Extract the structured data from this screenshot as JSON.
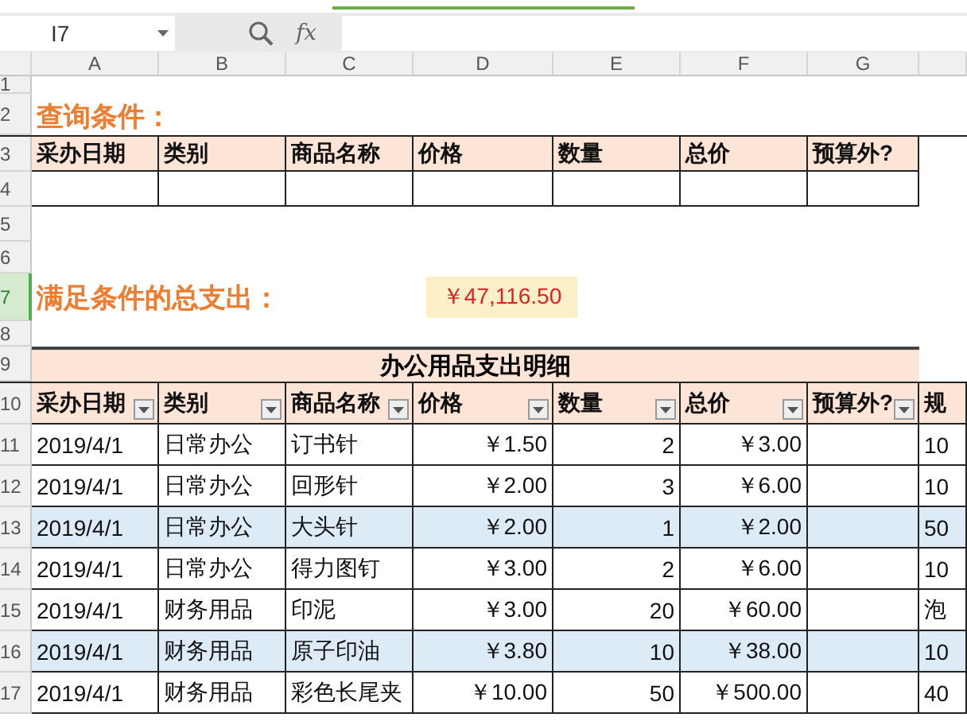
{
  "name_box": "I7",
  "formula_label": "fx",
  "column_headers": [
    "A",
    "B",
    "C",
    "D",
    "E",
    "F",
    "G"
  ],
  "row_numbers": [
    {
      "label": "1",
      "selected": false
    },
    {
      "label": "2",
      "selected": false
    },
    {
      "label": "3",
      "selected": false
    },
    {
      "label": "4",
      "selected": false
    },
    {
      "label": "5",
      "selected": false
    },
    {
      "label": "6",
      "selected": false
    },
    {
      "label": "7",
      "selected": true
    },
    {
      "label": "8",
      "selected": false
    },
    {
      "label": "9",
      "selected": false
    },
    {
      "label": "10",
      "selected": false
    },
    {
      "label": "11",
      "selected": false
    },
    {
      "label": "12",
      "selected": false
    },
    {
      "label": "13",
      "selected": false
    },
    {
      "label": "14",
      "selected": false
    },
    {
      "label": "15",
      "selected": false
    },
    {
      "label": "16",
      "selected": false
    },
    {
      "label": "17",
      "selected": false
    }
  ],
  "query_title": "查询条件：",
  "query_headers": [
    "采办日期",
    "类别",
    "商品名称",
    "价格",
    "数量",
    "总价",
    "预算外?"
  ],
  "total_label": "满足条件的总支出：",
  "total_value": "￥47,116.50",
  "table_title": "办公用品支出明细",
  "table_headers": [
    {
      "label": "采办日期",
      "filter": true
    },
    {
      "label": "类别",
      "filter": true
    },
    {
      "label": "商品名称",
      "filter": true
    },
    {
      "label": "价格",
      "filter": true
    },
    {
      "label": "数量",
      "filter": true
    },
    {
      "label": "总价",
      "filter": true
    },
    {
      "label": "预算外?",
      "filter": true
    },
    {
      "label": "规",
      "filter": false
    }
  ],
  "rows": [
    {
      "highlighted": false,
      "cells": [
        "2019/4/1",
        "日常办公",
        "订书针",
        "￥1.50",
        "2",
        "￥3.00",
        "",
        "10"
      ]
    },
    {
      "highlighted": false,
      "cells": [
        "2019/4/1",
        "日常办公",
        "回形针",
        "￥2.00",
        "3",
        "￥6.00",
        "",
        "10"
      ]
    },
    {
      "highlighted": true,
      "cells": [
        "2019/4/1",
        "日常办公",
        "大头针",
        "￥2.00",
        "1",
        "￥2.00",
        "",
        "50"
      ]
    },
    {
      "highlighted": false,
      "cells": [
        "2019/4/1",
        "日常办公",
        "得力图钉",
        "￥3.00",
        "2",
        "￥6.00",
        "",
        "10"
      ]
    },
    {
      "highlighted": false,
      "cells": [
        "2019/4/1",
        "财务用品",
        "印泥",
        "￥3.00",
        "20",
        "￥60.00",
        "",
        "泡"
      ]
    },
    {
      "highlighted": true,
      "cells": [
        "2019/4/1",
        "财务用品",
        "原子印油",
        "￥3.80",
        "10",
        "￥38.00",
        "",
        "10"
      ]
    },
    {
      "highlighted": false,
      "cells": [
        "2019/4/1",
        "财务用品",
        "彩色长尾夹",
        "￥10.00",
        "50",
        "￥500.00",
        "",
        "40"
      ]
    }
  ]
}
